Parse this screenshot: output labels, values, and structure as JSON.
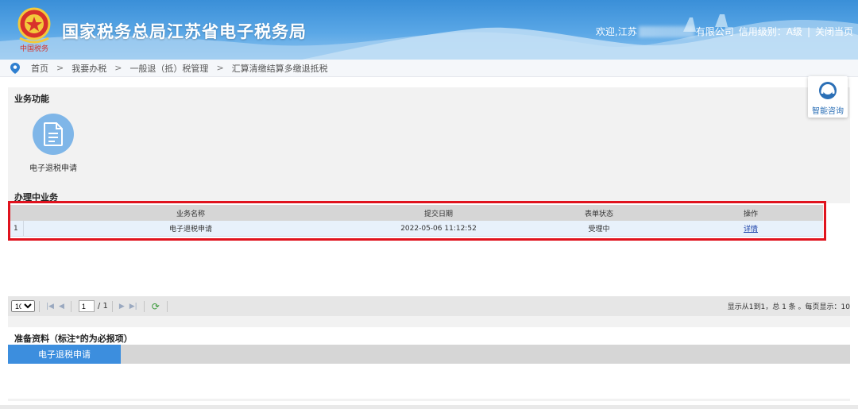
{
  "header": {
    "logo_text": "中国税务",
    "title": "国家税务总局江苏省电子税务局",
    "welcome_prefix": "欢迎,江苏",
    "company_suffix": "有限公司",
    "credit_level": "信用级别：A级",
    "separator": "|",
    "close_link": "关闭当页"
  },
  "breadcrumb": {
    "items": [
      "首页",
      "我要办税",
      "一般退（抵）税管理",
      "汇算清缴结算多缴退抵税"
    ],
    "separator": ">"
  },
  "business_functions": {
    "title": "业务功能",
    "items": [
      {
        "label": "电子退税申请",
        "icon": "document-icon"
      }
    ]
  },
  "in_progress": {
    "title": "办理中业务",
    "columns": [
      "业务名称",
      "提交日期",
      "表单状态",
      "操作"
    ],
    "rows": [
      {
        "index": "1",
        "name": "电子退税申请",
        "date": "2022-05-06 11:12:52",
        "status": "受理中",
        "action": "详情"
      }
    ]
  },
  "pager": {
    "page_size": "10",
    "current_page": "1",
    "total_pages": "/ 1",
    "info": "显示从1到1，总 1 条 。每页显示：10"
  },
  "prep_materials": {
    "title": "准备资料（标注*的为必报项）",
    "tabs": [
      "电子退税申请"
    ]
  },
  "consult": {
    "label": "智能咨询"
  },
  "colors": {
    "header_blue": "#3a8fd8",
    "accent_blue": "#3c8ede",
    "highlight_red": "#e0131e",
    "icon_circle": "#7fb6e8"
  }
}
